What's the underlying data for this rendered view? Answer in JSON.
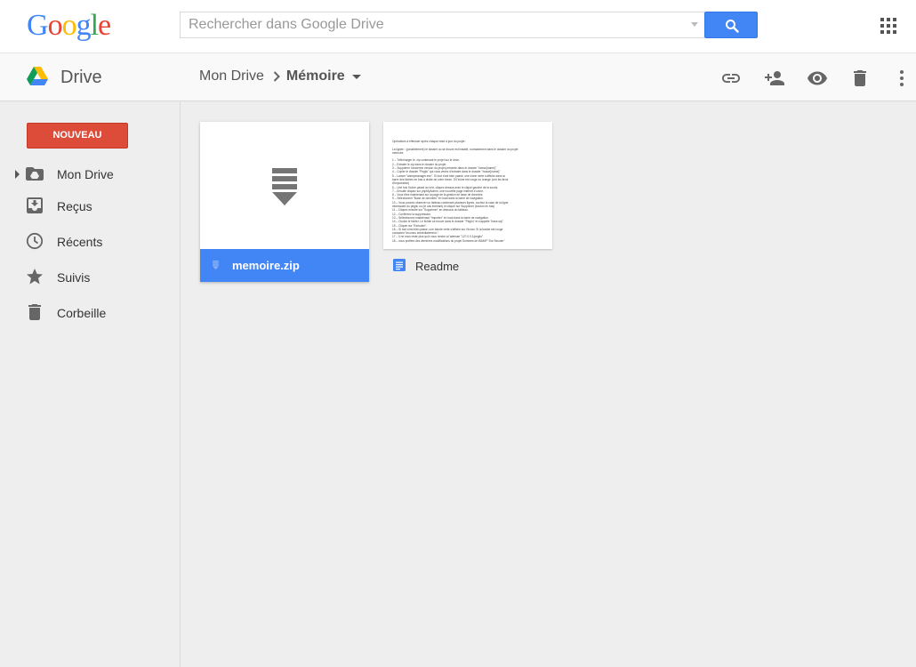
{
  "header": {
    "logo": {
      "letters": [
        {
          "ch": "G",
          "color": "#4285f4"
        },
        {
          "ch": "o",
          "color": "#ea4335"
        },
        {
          "ch": "o",
          "color": "#fbbc05"
        },
        {
          "ch": "g",
          "color": "#4285f4"
        },
        {
          "ch": "l",
          "color": "#34a853"
        },
        {
          "ch": "e",
          "color": "#ea4335"
        }
      ]
    },
    "search": {
      "placeholder": "Rechercher dans Google Drive",
      "value": "",
      "button_icon": "search-icon"
    },
    "apps_icon": "apps-grid-icon"
  },
  "toolbar": {
    "app_name": "Drive",
    "breadcrumb": {
      "root": "Mon Drive",
      "current": "Mémoire"
    },
    "actions": [
      "link-icon",
      "add-person-icon",
      "preview-eye-icon",
      "trash-icon",
      "more-vertical-icon"
    ]
  },
  "sidebar": {
    "new_button": "NOUVEAU",
    "items": [
      {
        "label": "Mon Drive",
        "icon": "drive-folder-icon"
      },
      {
        "label": "Reçus",
        "icon": "inbox-icon"
      },
      {
        "label": "Récents",
        "icon": "clock-icon"
      },
      {
        "label": "Suivis",
        "icon": "star-icon"
      },
      {
        "label": "Corbeille",
        "icon": "trash-icon"
      }
    ]
  },
  "files": [
    {
      "name": "memoire.zip",
      "type": "zip",
      "selected": true
    },
    {
      "name": "Readme",
      "type": "document",
      "preview_lines": [
        "Opérations à effectuer après chaque mise à jour du projet :",
        "",
        "La lignée : (possiblement) le dossier où se trouve est installé, normalement dans le dossier du projet",
        "memoire.",
        "",
        "1 – Télécharger le .zip contenant le projet sur le drive.",
        "2 – Extraire le zip dans le dossier du projet.",
        "3 – Supprimer l'ancienne version du projet présente dans le dossier \"/www/{name}\"",
        "4 – Copier le dossier \"Pegilu\" qui vous venez d'extraire dans le dossier \"/www/{name}\"",
        "5 – Lancer \"wampmanager.exe\". Si tout s'est bien passé, une icône verte s'affiche dans la",
        "barre des tâches en bas à droite de votre écran. Si l'icône est rouge ou orange (voir les liens",
        "d'importation)",
        "6 – Une fois l'icône passé au vert, cliquez dessus avec le clique gauche de la souris.",
        "7 – Ensuite cliquez sur phpMyAdmin, une nouvelle page internet s'ouvre.",
        "8 – Vous êtes maintenant sur la page de la gestion de base de données.",
        "9 – Sélectionner \"Base de données\" en haut dans la barre de navigation.",
        "10 – Vous pouvez observer un tableau contenant plusieurs lignes, cochez la case de la ligne",
        "nécessaire du pegilu ou (le cas échéant) et cliquer sur Supprimer (bouton en bas)",
        "11 – Cliquez ensuite sur \"Supprimer\" en dessous du tableau.",
        "12 – Confirmez la suppression.",
        "13 – Sélectionnez maintenant \"Importer\" en haut dans la barre de navigation.",
        "14 – Choisir le fichier. Le fichier se trouve dans le dossier \"Pegilu\" et s'appelle \"base.sql\".",
        "15 – Cliquer sur \"Exécuter\".",
        "16 – Si tout s'est bien passé, une bande verte s'affiche sur l'écran. Si la bande est rouge",
        "contactez l'inconnu immédiatement !",
        "17 – Il ne vous reste plus qu'à vous rendre à l'adresse \"127.0.0.1/pegilu\"",
        "18 – vous profitez des dernières modifications du projet Sommes de WAMP \"Sur Seculer\""
      ]
    }
  ]
}
